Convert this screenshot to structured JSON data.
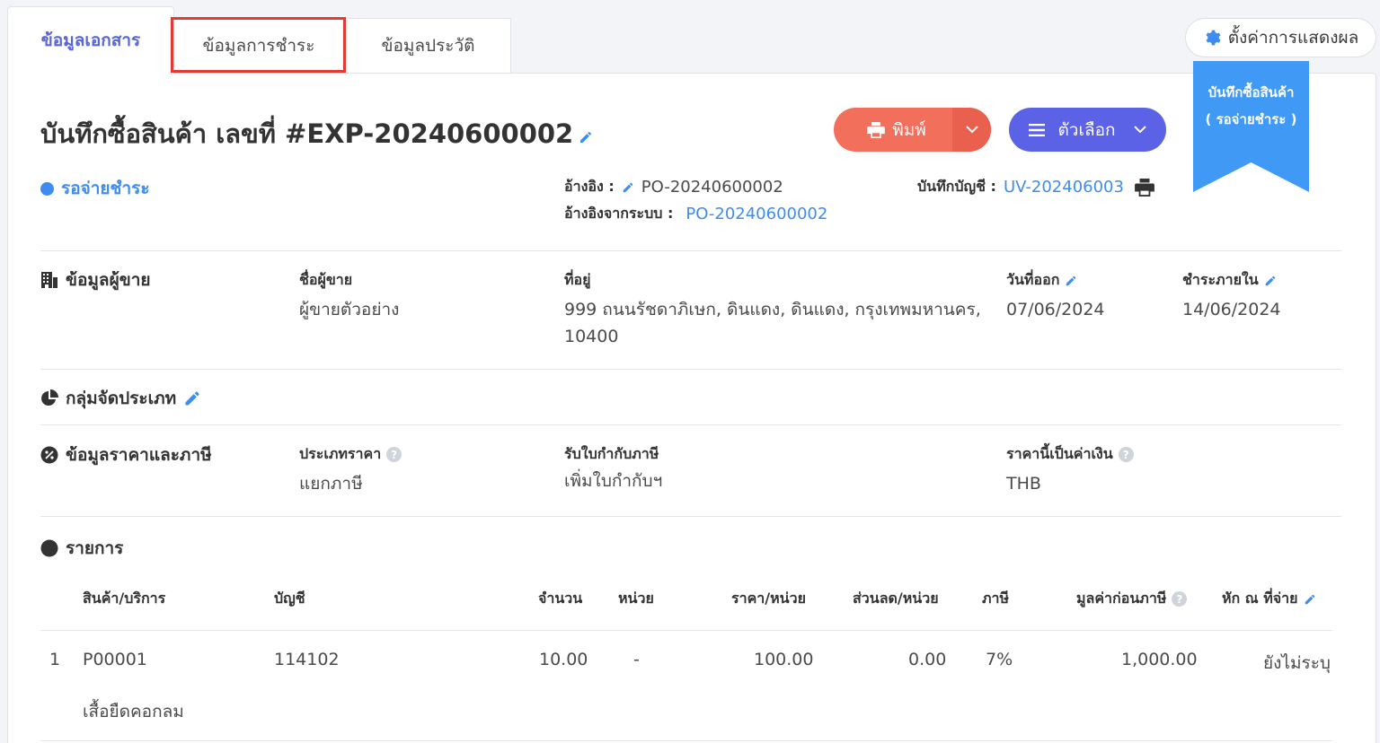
{
  "tabs": {
    "doc_info": "ข้อมูลเอกสาร",
    "payment_info": "ข้อมูลการชำระ",
    "history": "ข้อมูลประวัติ"
  },
  "settings_label": "ตั้งค่าการแสดงผล",
  "ribbon": {
    "line1": "บันทึกซื้อสินค้า",
    "line2": "( รอจ่ายชำระ )"
  },
  "document": {
    "title": "บันทึกซื้อสินค้า เลขที่ #EXP-20240600002",
    "status": "รอจ่ายชำระ",
    "ref_label": "อ้างอิง :",
    "ref_value": "PO-20240600002",
    "system_ref_label": "อ้างอิงจากระบบ :",
    "system_ref_value": "PO-20240600002",
    "account_label": "บันทึกบัญชี :",
    "account_value": "UV-202406003"
  },
  "actions": {
    "print": "พิมพ์",
    "options": "ตัวเลือก"
  },
  "vendor": {
    "section": "ข้อมูลผู้ขาย",
    "name_label": "ชื่อผู้ขาย",
    "name_value": "ผู้ขายตัวอย่าง",
    "address_label": "ที่อยู่",
    "address_line1": "999 ถนนรัชดาภิเษก, ดินแดง, ดินแดง, กรุงเทพมหานคร,",
    "address_line2": "10400",
    "issue_date_label": "วันที่ออก",
    "issue_date_value": "07/06/2024",
    "due_label": "ชำระภายใน",
    "due_value": "14/06/2024"
  },
  "category": {
    "section": "กลุ่มจัดประเภท"
  },
  "pricing": {
    "section": "ข้อมูลราคาและภาษี",
    "price_type_label": "ประเภทราคา",
    "price_type_value": "แยกภาษี",
    "tax_invoice_label": "รับใบกำกับภาษี",
    "tax_invoice_value": "เพิ่มใบกำกับฯ",
    "currency_label": "ราคานี้เป็นค่าเงิน",
    "currency_value": "THB"
  },
  "items": {
    "section": "รายการ",
    "headers": {
      "product": "สินค้า/บริการ",
      "account": "บัญชี",
      "qty": "จำนวน",
      "unit": "หน่วย",
      "price": "ราคา/หน่วย",
      "discount": "ส่วนลด/หน่วย",
      "tax": "ภาษี",
      "pre_tax": "มูลค่าก่อนภาษี",
      "withholding": "หัก ณ ที่จ่าย"
    },
    "rows": [
      {
        "no": "1",
        "code": "P00001",
        "description": "เสื้อยืดคอกลม",
        "account": "114102",
        "qty": "10.00",
        "unit": "-",
        "price": "100.00",
        "discount": "0.00",
        "tax": "7%",
        "pre_tax": "1,000.00",
        "withholding": "ยังไม่ระบุ"
      }
    ]
  }
}
